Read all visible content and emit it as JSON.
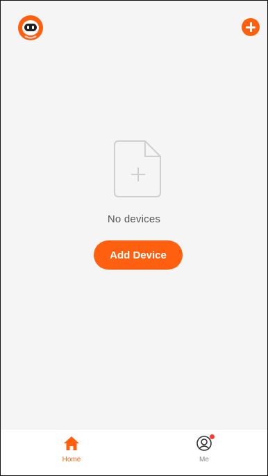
{
  "header": {
    "avatar_icon": "robot-avatar-icon",
    "add_icon": "plus-circle-icon"
  },
  "empty_state": {
    "icon": "file-add-icon",
    "message": "No devices",
    "button_label": "Add Device"
  },
  "tabbar": {
    "tabs": [
      {
        "label": "Home",
        "icon": "home-icon",
        "active": true
      },
      {
        "label": "Me",
        "icon": "user-icon",
        "active": false,
        "badge": true
      }
    ]
  },
  "colors": {
    "accent": "#ff6010",
    "background": "#f5f5f5",
    "badge": "#ff3b30",
    "muted_text": "#888888"
  }
}
